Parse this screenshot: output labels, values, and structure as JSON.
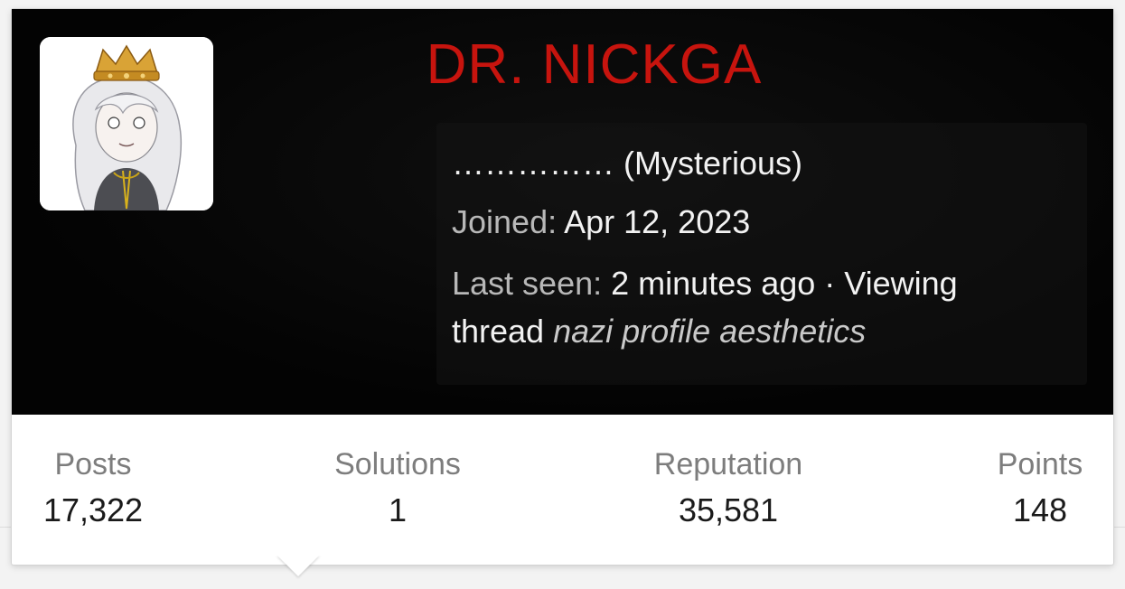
{
  "profile": {
    "username": "DR. NICKGA",
    "user_title": "…………… (Mysterious)",
    "joined_label": "Joined:",
    "joined_value": "Apr 12, 2023",
    "last_seen_label": "Last seen:",
    "last_seen_value": "2 minutes ago · Viewing thread",
    "thread_title": "nazi profile aesthetics",
    "avatar_icon": "crowned-anime-avatar",
    "username_color": "#c7140e"
  },
  "stats": [
    {
      "label": "Posts",
      "value": "17,322"
    },
    {
      "label": "Solutions",
      "value": "1"
    },
    {
      "label": "Reputation",
      "value": "35,581"
    },
    {
      "label": "Points",
      "value": "148"
    }
  ]
}
